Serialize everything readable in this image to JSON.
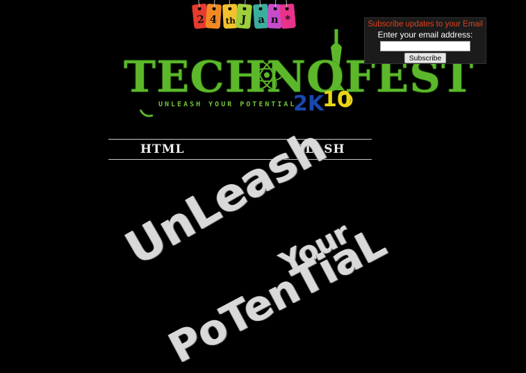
{
  "date_tags": {
    "chars": [
      "2",
      "4",
      "th",
      "J",
      "a",
      "n",
      "*"
    ],
    "colors": [
      "#e83a2e",
      "#f28a24",
      "#f2c12e",
      "#9ccf3a",
      "#3aaf9d",
      "#c74cc9",
      "#e8338a"
    ]
  },
  "logo": {
    "name": "TECHNOFEST",
    "tagline": "UNLEASH YOUR POTENTIAL",
    "year_2k": "2K",
    "year_10": "10"
  },
  "nav": {
    "html_label": "HTML",
    "flash_label": "FLASH"
  },
  "slogan": {
    "line1": "UnLeash",
    "line2": "Your",
    "line3": "PoTenTiaL"
  },
  "subscribe": {
    "title": "Subscribe updates to your Email",
    "label": "Enter your email address:",
    "input_value": "",
    "button_label": "Subscribe"
  }
}
